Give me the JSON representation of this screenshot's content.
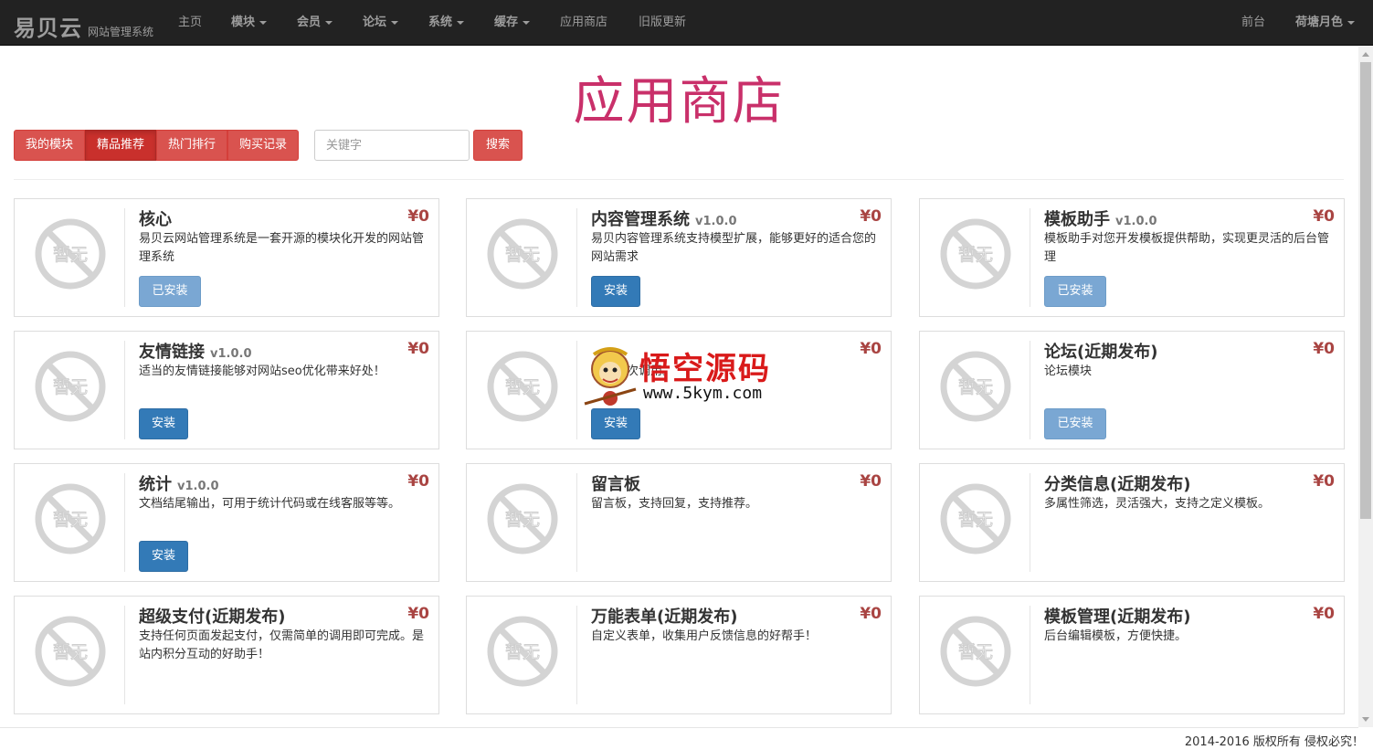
{
  "navbar": {
    "brand": "易贝云",
    "brand_sub": "网站管理系统",
    "items": [
      {
        "label": "主页"
      },
      {
        "label": "模块"
      },
      {
        "label": "会员"
      },
      {
        "label": "论坛"
      },
      {
        "label": "系统"
      },
      {
        "label": "缓存"
      },
      {
        "label": "应用商店"
      },
      {
        "label": "旧版更新"
      }
    ],
    "right": [
      {
        "label": "前台"
      },
      {
        "label": "荷塘月色"
      }
    ]
  },
  "page": {
    "title": "应用商店"
  },
  "filters": {
    "buttons": [
      {
        "label": "我的模块"
      },
      {
        "label": "精品推荐"
      },
      {
        "label": "热门排行"
      },
      {
        "label": "购买记录"
      }
    ],
    "search_placeholder": "关键字",
    "search_button": "搜索"
  },
  "thumb_text": "暂无",
  "apps": [
    {
      "name": "核心",
      "version": "",
      "price": "¥0",
      "desc": "易贝云网站管理系统是一套开源的模块化开发的网站管理系统",
      "action": "已安装"
    },
    {
      "name": "内容管理系统",
      "version": "v1.0.0",
      "price": "¥0",
      "desc": "易贝内容管理系统支持模型扩展，能够更好的适合您的网站需求",
      "action": "安装"
    },
    {
      "name": "模板助手",
      "version": "v1.0.0",
      "price": "¥0",
      "desc": "模板助手对您开发模板提供帮助，实现更灵活的后台管理",
      "action": "已安装"
    },
    {
      "name": "友情链接",
      "version": "v1.0.0",
      "price": "¥0",
      "desc": "适当的友情链接能够对网站seo优化带来好处！",
      "action": "安装"
    },
    {
      "name": "",
      "version": "",
      "price": "¥0",
      "desc": "页面多次调用。",
      "action": "安装"
    },
    {
      "name": "论坛(近期发布)",
      "version": "",
      "price": "¥0",
      "desc": "论坛模块",
      "action": "已安装"
    },
    {
      "name": "统计",
      "version": "v1.0.0",
      "price": "¥0",
      "desc": "文档结尾输出，可用于统计代码或在线客服等等。",
      "action": "安装"
    },
    {
      "name": "留言板",
      "version": "",
      "price": "¥0",
      "desc": "留言板，支持回复，支持推荐。",
      "action": ""
    },
    {
      "name": "分类信息(近期发布)",
      "version": "",
      "price": "¥0",
      "desc": "多属性筛选，灵活强大，支持之定义模板。",
      "action": ""
    },
    {
      "name": "超级支付(近期发布)",
      "version": "",
      "price": "¥0",
      "desc": "支持任何页面发起支付，仅需简单的调用即可完成。是站内积分互动的好助手！",
      "action": ""
    },
    {
      "name": "万能表单(近期发布)",
      "version": "",
      "price": "¥0",
      "desc": "自定义表单，收集用户反馈信息的好帮手！",
      "action": ""
    },
    {
      "name": "模板管理(近期发布)",
      "version": "",
      "price": "¥0",
      "desc": "后台编辑模板，方便快捷。",
      "action": ""
    }
  ],
  "watermark": {
    "text": "悟空源码",
    "url": "www.5kym.com"
  },
  "footer": {
    "text": "2014-2016 版权所有 侵权必究！"
  },
  "colors": {
    "navbar": "#222222",
    "title": "#c9306a",
    "danger": "#d9534f",
    "primary": "#337ab7",
    "price": "#a94442"
  }
}
